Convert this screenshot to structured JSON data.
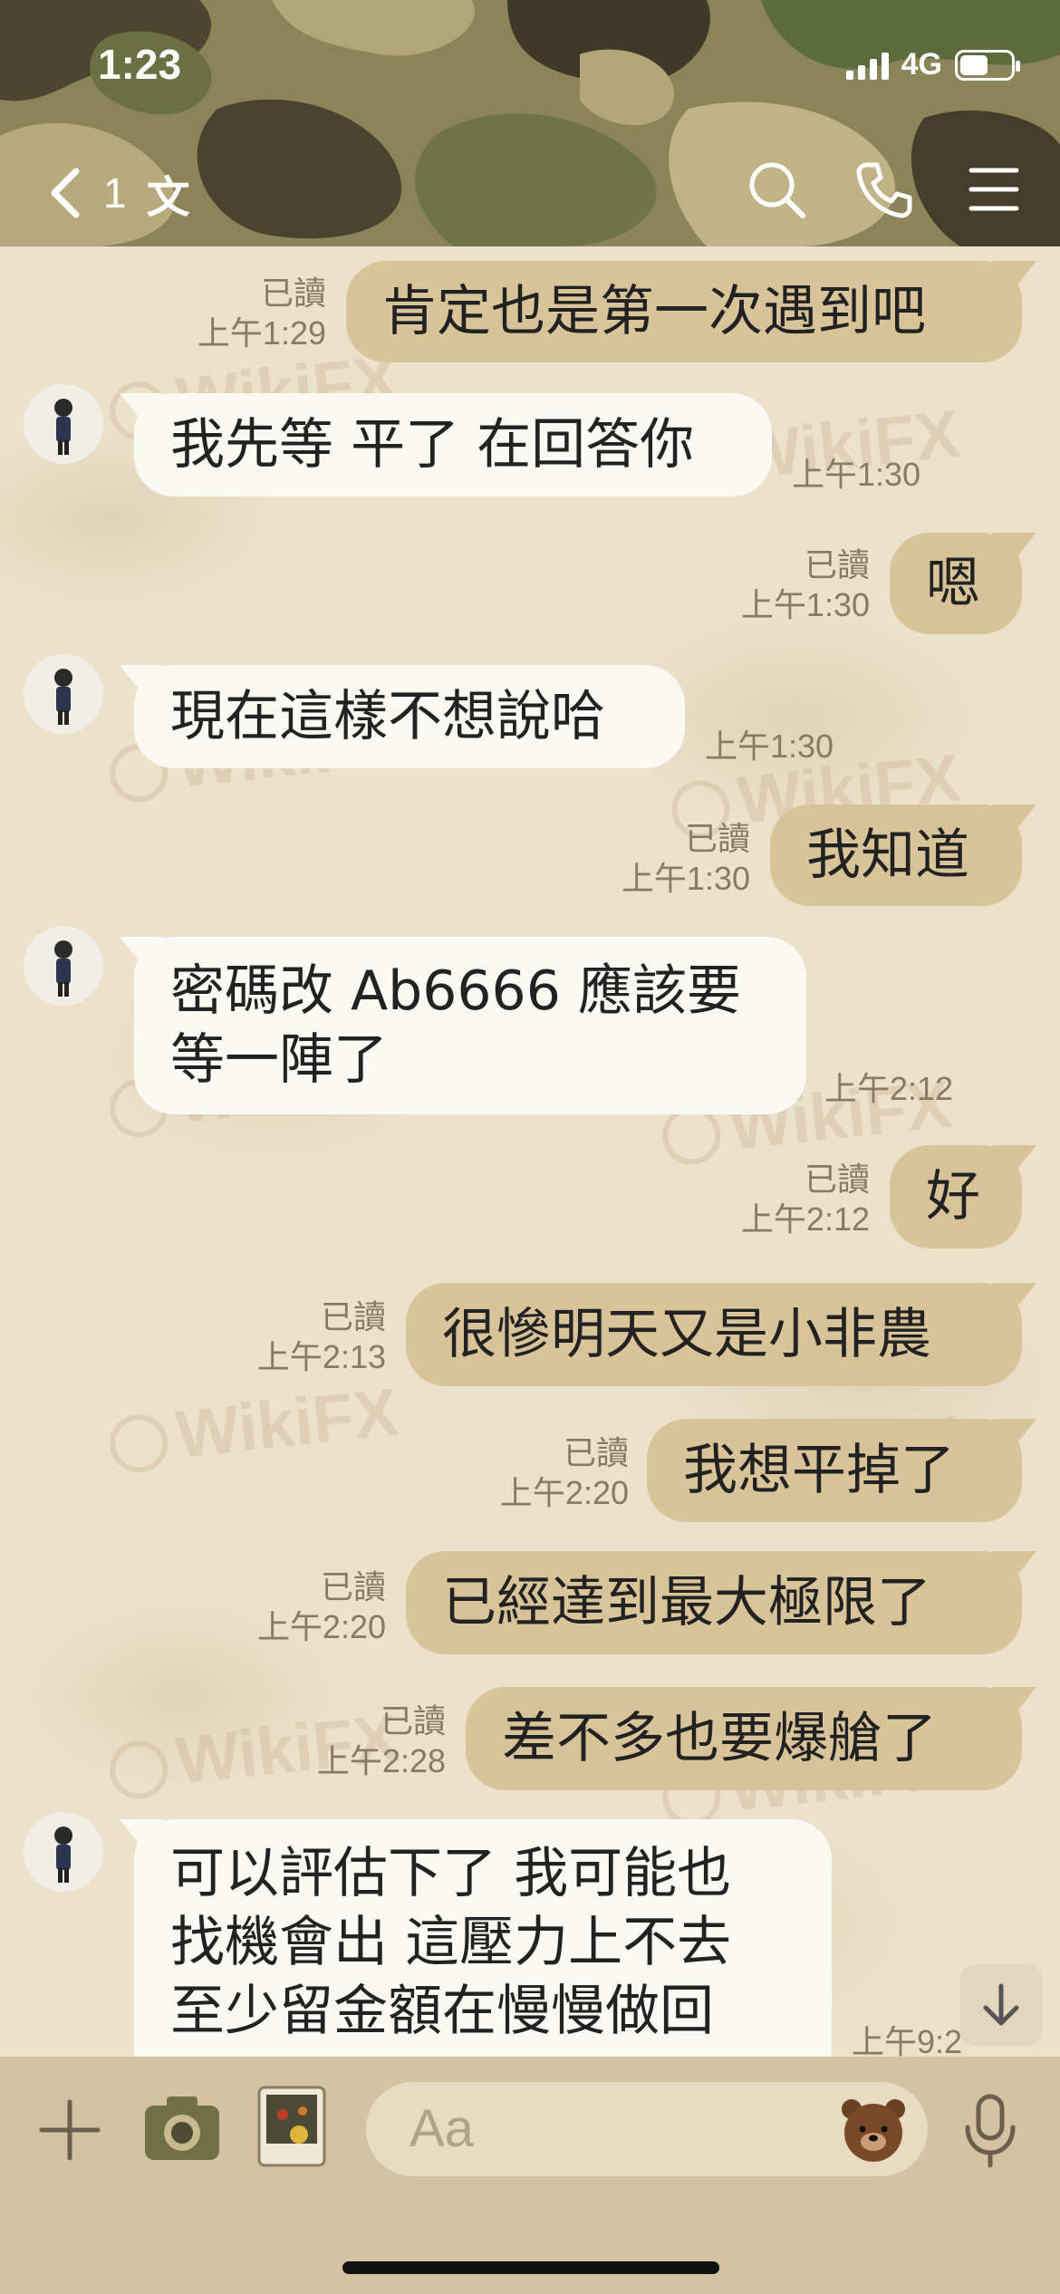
{
  "status_bar": {
    "time": "1:23",
    "network": "4G"
  },
  "header": {
    "back_count": "1",
    "title": "文"
  },
  "watermark": "WikiFX",
  "messages": [
    {
      "side": "out",
      "text": "肯定也是第一次遇到吧",
      "read": "已讀",
      "time": "上午1:29"
    },
    {
      "side": "in",
      "text": "我先等 平了 在回答你",
      "time": "上午1:30"
    },
    {
      "side": "out",
      "text": "嗯",
      "read": "已讀",
      "time": "上午1:30"
    },
    {
      "side": "in",
      "text": "現在這樣不想說哈",
      "time": "上午1:30"
    },
    {
      "side": "out",
      "text": "我知道",
      "read": "已讀",
      "time": "上午1:30"
    },
    {
      "side": "in",
      "line1": "密碼改 Ab6666 應該要",
      "line2": "等一陣了",
      "time": "上午2:12"
    },
    {
      "side": "out",
      "text": "好",
      "read": "已讀",
      "time": "上午2:12"
    },
    {
      "side": "out",
      "text": "很慘明天又是小非農",
      "read": "已讀",
      "time": "上午2:13"
    },
    {
      "side": "out",
      "text": "我想平掉了",
      "read": "已讀",
      "time": "上午2:20"
    },
    {
      "side": "out",
      "text": "已經達到最大極限了",
      "read": "已讀",
      "time": "上午2:20"
    },
    {
      "side": "out",
      "text": "差不多也要爆艙了",
      "read": "已讀",
      "time": "上午2:28"
    },
    {
      "side": "in",
      "line1": "可以評估下了 我可能也",
      "line2": "找機會出 這壓力上不去",
      "line3": "至少留金額在慢慢做回",
      "time": "上午9:2"
    }
  ],
  "composer": {
    "placeholder": "Aa"
  },
  "colors": {
    "header_camo": "#7d7652",
    "bubble_out": "#d9c49a",
    "bubble_in": "#fbf9f4",
    "bottom_bar": "#d4c2a3"
  },
  "icons": [
    "chevron-left-icon",
    "search-icon",
    "phone-icon",
    "menu-icon",
    "plus-icon",
    "camera-icon",
    "sticker-photo-icon",
    "bear-emoji-icon",
    "microphone-icon",
    "arrow-down-icon"
  ]
}
